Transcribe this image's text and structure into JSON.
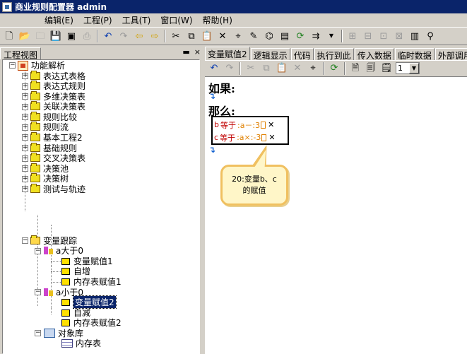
{
  "window": {
    "title": "商业规则配置器 admin"
  },
  "menu": [
    "编辑(E)",
    "工程(P)",
    "工具(T)",
    "窗口(W)",
    "帮助(H)"
  ],
  "left_panel": {
    "tab_label": "工程视图",
    "ctrl_min": "▬",
    "ctrl_close": "×"
  },
  "tree": {
    "root": "功能解析",
    "items": [
      "表达式表格",
      "表达式规则",
      "多维决策表",
      "关联决策表",
      "规则比较",
      "规则流",
      "基本工程2",
      "基础规则",
      "交叉决策表",
      "决策池",
      "决策树",
      "测试与轨迹",
      "变量跟踪"
    ],
    "group_a": {
      "label": "a大于0",
      "children": [
        "变量赋值1",
        "自增",
        "内存表赋值1"
      ]
    },
    "group_b": {
      "label": "a小于0",
      "children": [
        "变量赋值2",
        "自减",
        "内存表赋值2"
      ]
    },
    "objlib": {
      "label": "对象库",
      "children": [
        "内存表"
      ]
    }
  },
  "tabs": [
    "变量赋值2",
    "逻辑显示",
    "代码",
    "执行到此",
    "传入数据",
    "临时数据",
    "外部调用"
  ],
  "right_toolbar": {
    "page_value": "1"
  },
  "editor": {
    "if_label": "如果:",
    "then_label": "那么:",
    "assignments": [
      {
        "var": "b",
        "op": "等于",
        "expr": ":a－:3"
      },
      {
        "var": "c",
        "op": "等于",
        "expr": ":a×:-3"
      }
    ],
    "callout": {
      "line1": "20:变量b、c",
      "line2": "的赋值"
    }
  }
}
